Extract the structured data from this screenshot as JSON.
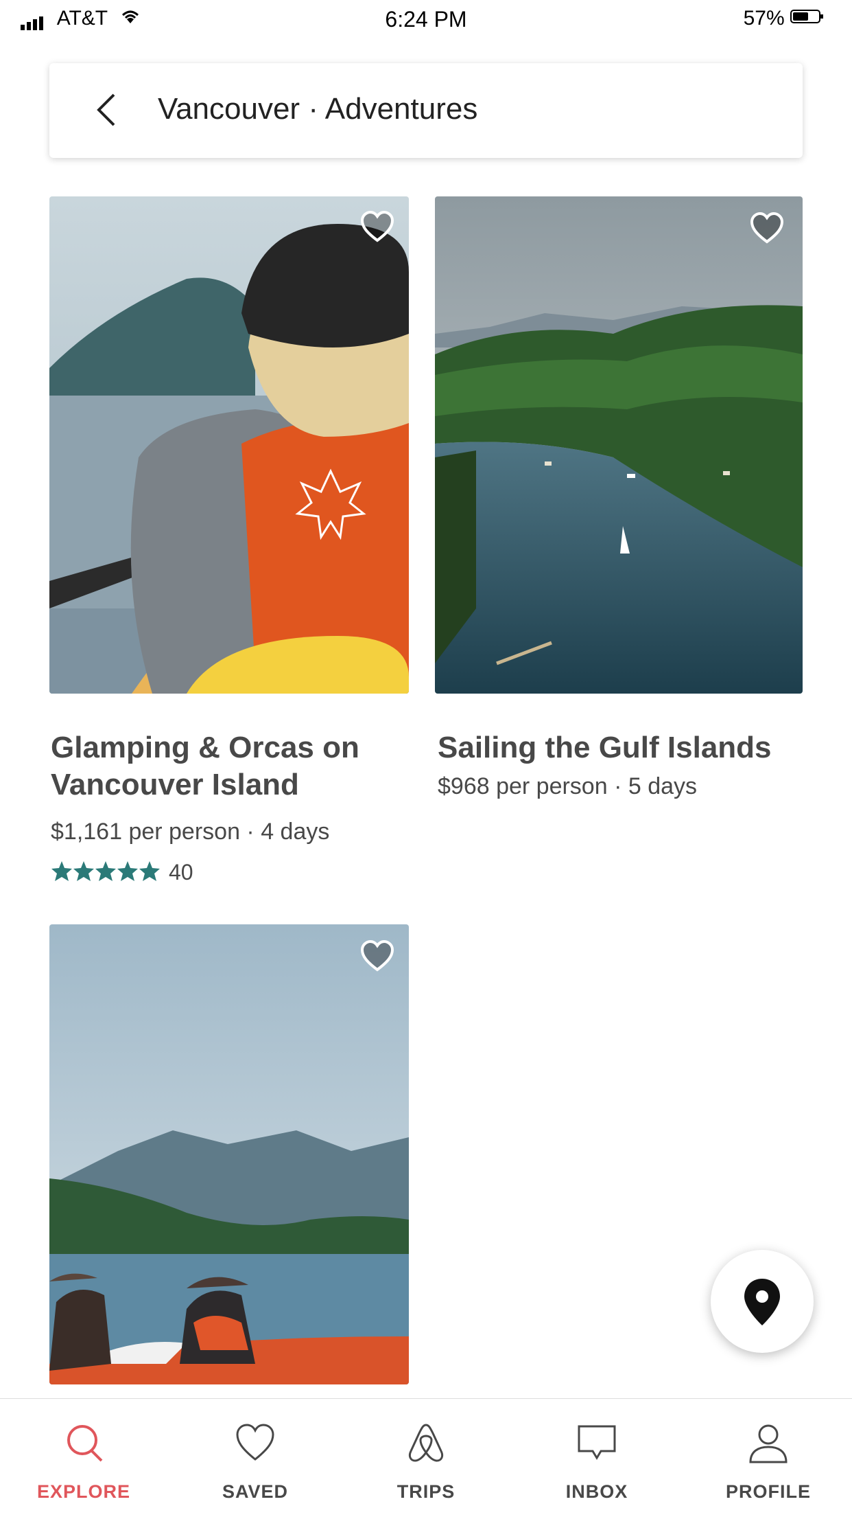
{
  "status_bar": {
    "carrier": "AT&T",
    "time": "6:24 PM",
    "battery": "57%"
  },
  "search": {
    "title": "Vancouver · Adventures"
  },
  "colors": {
    "accent": "#e0565b",
    "star": "#2b7a78",
    "text": "#484848"
  },
  "listings": [
    {
      "title_line1": "Glamping & Orcas on",
      "title_line2": "Vancouver Island",
      "meta": "$1,161 per person · 4 days",
      "rating": 5,
      "reviews": "40",
      "icon": "heart-icon"
    },
    {
      "title_line1": "Sailing the Gulf Islands",
      "meta": "$968 per person · 5 days",
      "icon": "heart-icon"
    },
    {
      "icon": "heart-icon"
    }
  ],
  "fab": {
    "icon": "map-pin-icon"
  },
  "tabs": [
    {
      "label": "EXPLORE",
      "icon": "search-icon",
      "active": true
    },
    {
      "label": "SAVED",
      "icon": "heart-icon"
    },
    {
      "label": "TRIPS",
      "icon": "airbnb-logo-icon"
    },
    {
      "label": "INBOX",
      "icon": "message-icon"
    },
    {
      "label": "PROFILE",
      "icon": "person-icon"
    }
  ]
}
